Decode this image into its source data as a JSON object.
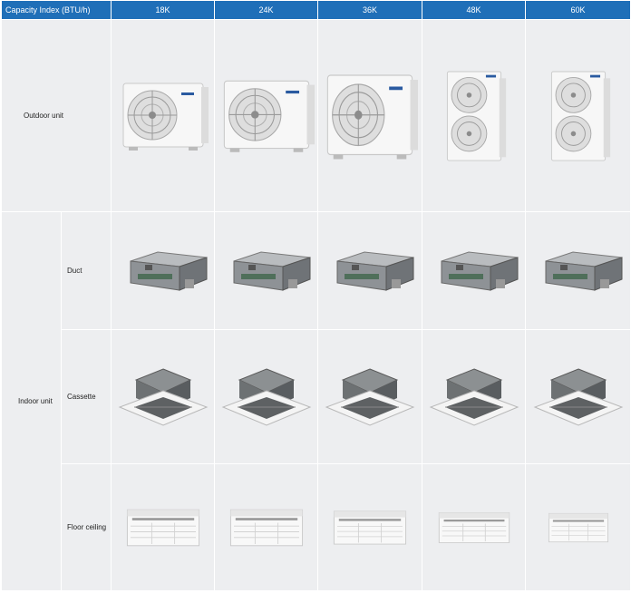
{
  "header": {
    "capacity_label": "Capacity Index  (BTU/h)",
    "capacities": [
      "18K",
      "24K",
      "36K",
      "48K",
      "60K"
    ]
  },
  "rows": {
    "outdoor": "Outdoor unit",
    "indoor": "Indoor unit",
    "duct": "Duct",
    "cassette": "Cassette",
    "floor_ceiling": "Floor ceiling"
  },
  "colors": {
    "header_bg": "#1f6fb8",
    "cell_bg": "#edeef0",
    "grid_line": "#ffffff"
  },
  "images": {
    "outdoor": [
      "outdoor-unit-single-fan",
      "outdoor-unit-single-fan",
      "outdoor-unit-single-fan",
      "outdoor-unit-double-fan",
      "outdoor-unit-double-fan"
    ],
    "duct": [
      "duct-unit",
      "duct-unit",
      "duct-unit",
      "duct-unit",
      "duct-unit"
    ],
    "cassette": [
      "cassette-unit",
      "cassette-unit",
      "cassette-unit",
      "cassette-unit",
      "cassette-unit"
    ],
    "floor_ceiling": [
      "floor-ceiling-unit",
      "floor-ceiling-unit",
      "floor-ceiling-unit",
      "floor-ceiling-unit",
      "floor-ceiling-unit"
    ]
  }
}
